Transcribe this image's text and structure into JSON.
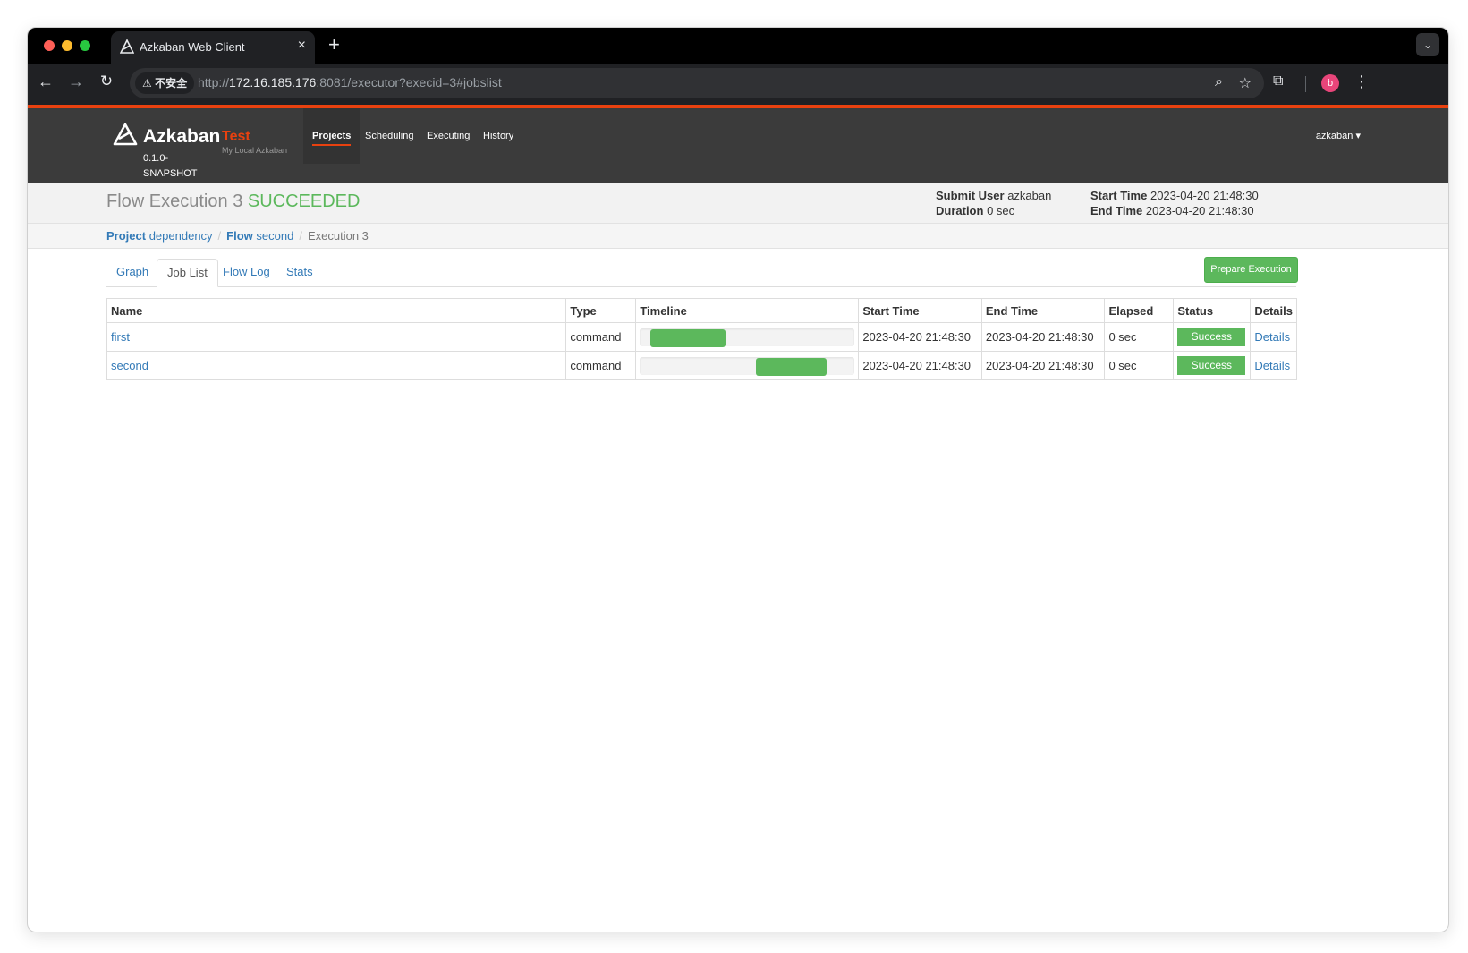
{
  "browser": {
    "tab_title": "Azkaban Web Client",
    "tab_close_icon": "close-icon",
    "new_tab_icon": "plus-icon",
    "security_label": "⚠ 不安全",
    "url_scheme": "http://",
    "url_host": "172.16.185.176",
    "url_rest": ":8081/executor?execid=3#jobslist",
    "profile_initial": "b"
  },
  "header": {
    "brand": "Azkaban",
    "version": "0.1.0-SNAPSHOT",
    "env_name": "Test",
    "env_description": "My Local Azkaban",
    "nav": [
      "Projects",
      "Scheduling",
      "Executing",
      "History"
    ],
    "user": "azkaban",
    "accent_color": "#e8410f"
  },
  "flow": {
    "title_prefix": "Flow Execution",
    "exec_id": "3",
    "status": "SUCCEEDED",
    "submit_user_label": "Submit User",
    "submit_user": "azkaban",
    "duration_label": "Duration",
    "duration": "0 sec",
    "start_time_label": "Start Time",
    "start_time": "2023-04-20 21:48:30",
    "end_time_label": "End Time",
    "end_time": "2023-04-20 21:48:30"
  },
  "breadcrumb": {
    "project_label": "Project",
    "project": "dependency",
    "flow_label": "Flow",
    "flow": "second",
    "execution": "Execution 3"
  },
  "tabs": [
    "Graph",
    "Job List",
    "Flow Log",
    "Stats"
  ],
  "actions": {
    "prepare_execution": "Prepare Execution"
  },
  "table": {
    "columns": [
      "Name",
      "Type",
      "Timeline",
      "Start Time",
      "End Time",
      "Elapsed",
      "Status",
      "Details"
    ],
    "rows": [
      {
        "name": "first",
        "type": "command",
        "timeline_start": 0.05,
        "timeline_end": 0.4,
        "start": "2023-04-20 21:48:30",
        "end": "2023-04-20 21:48:30",
        "elapsed": "0 sec",
        "status": "Success",
        "details": "Details"
      },
      {
        "name": "second",
        "type": "command",
        "timeline_start": 0.54,
        "timeline_end": 0.87,
        "start": "2023-04-20 21:48:30",
        "end": "2023-04-20 21:48:30",
        "elapsed": "0 sec",
        "status": "Success",
        "details": "Details"
      }
    ]
  }
}
